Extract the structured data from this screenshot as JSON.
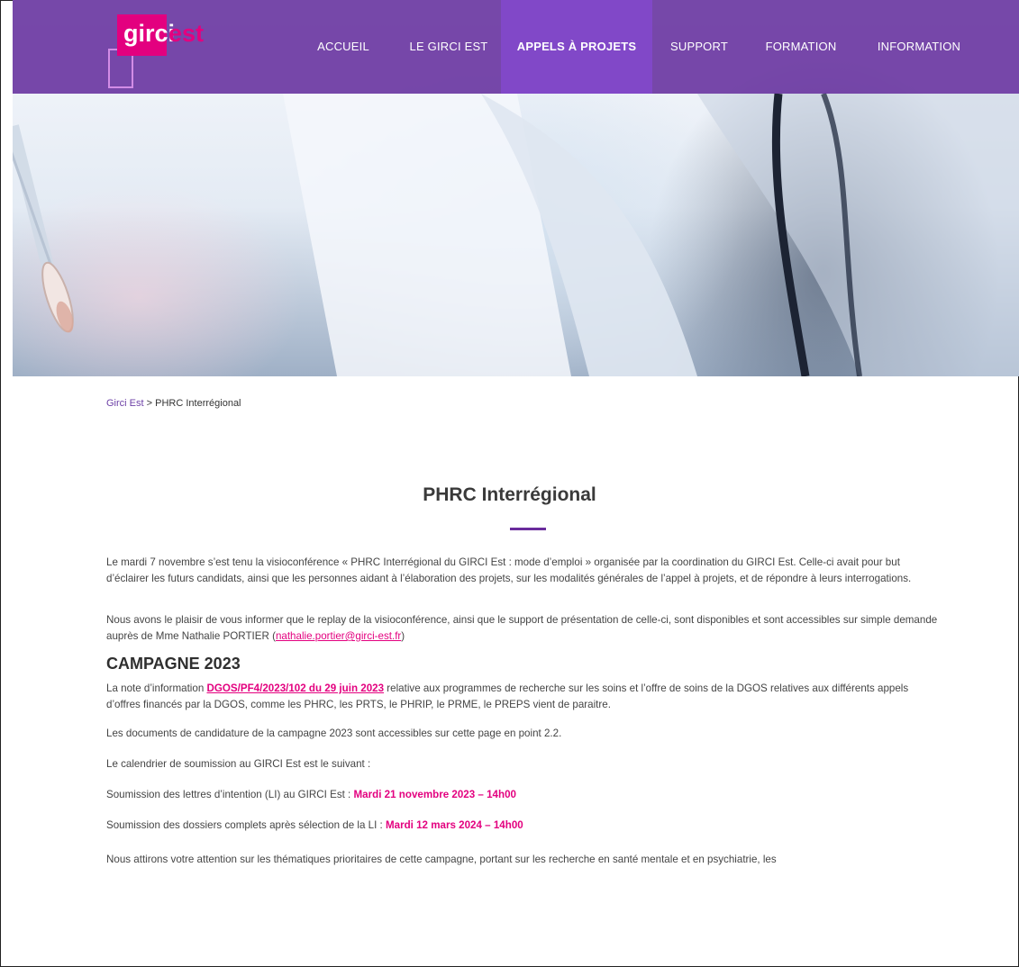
{
  "colors": {
    "brand_purple": "#6834a0",
    "nav_active": "#8148c8",
    "accent_pink": "#e3007f"
  },
  "logo": {
    "part1": "girci",
    "part2": "est"
  },
  "nav": {
    "items": [
      {
        "label": "ACCUEIL"
      },
      {
        "label": "LE GIRCI EST"
      },
      {
        "label": "APPELS À PROJETS"
      },
      {
        "label": "SUPPORT"
      },
      {
        "label": "FORMATION"
      },
      {
        "label": "INFORMATION"
      }
    ],
    "active_index": 2
  },
  "breadcrumb": {
    "home": "Girci Est",
    "separator": ">",
    "current": "PHRC Interrégional"
  },
  "page": {
    "title": "PHRC Interrégional",
    "para1": "Le mardi 7 novembre s’est tenu la visioconférence « PHRC Interrégional du GIRCI Est : mode d’emploi » organisée par la coordination du GIRCI Est. Celle-ci avait pour but d’éclairer les futurs candidats, ainsi que les personnes aidant à l’élaboration des projets, sur les modalités générales de l’appel à projets, et de répondre à leurs interrogations.",
    "para2_before": "Nous avons le plaisir de vous informer que le replay de la visioconférence, ainsi que le support de présentation de celle-ci, sont disponibles et sont accessibles sur simple demande auprès de Mme Nathalie PORTIER (",
    "para2_email": "nathalie.portier@girci-est.fr",
    "para2_after": ")",
    "section_title": "CAMPAGNE 2023",
    "para3_before": "La note d’information ",
    "para3_link": "DGOS/PF4/2023/102 du 29 juin 2023",
    "para3_after": " relative aux programmes de recherche sur les soins et l’offre de soins de la DGOS relatives aux différents appels d’offres financés par la DGOS, comme les PHRC, les PRTS, le PHRIP, le PRME, le PREPS vient de paraitre.",
    "para4": "Les documents de candidature de la campagne 2023  sont accessibles sur cette page en point 2.2.",
    "para5": "Le calendrier de soumission au GIRCI Est est le suivant :",
    "para6_before": "Soumission des lettres d’intention (LI) au GIRCI Est : ",
    "para6_highlight": "Mardi 21 novembre 2023 – 14h00",
    "para7_before": "Soumission des dossiers complets après sélection de la LI : ",
    "para7_highlight": "Mardi 12 mars 2024 – 14h00",
    "para8": "Nous attirons votre attention sur les thématiques prioritaires de cette campagne, portant sur les recherche en santé mentale et en psychiatrie, les"
  }
}
